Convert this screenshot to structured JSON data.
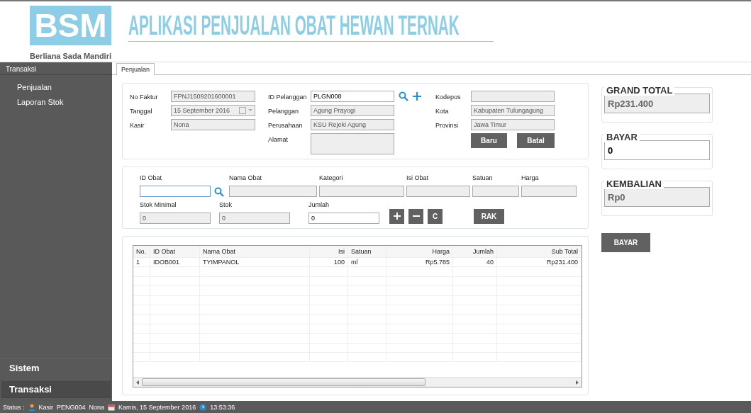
{
  "header": {
    "logo": "BSM",
    "company": "Berliana Sada Mandiri",
    "title": "APLIKASI PENJUALAN OBAT HEWAN TERNAK"
  },
  "sidebar": {
    "section": "Transaksi",
    "items": [
      {
        "label": "Penjualan"
      },
      {
        "label": "Laporan Stok"
      }
    ],
    "groups": [
      {
        "label": "Sistem",
        "selected": false
      },
      {
        "label": "Transaksi",
        "selected": true
      }
    ]
  },
  "tabs": [
    {
      "label": "Penjualan",
      "selected": true
    }
  ],
  "customer_panel": {
    "columns": [
      [
        {
          "label": "No Faktur",
          "value": "FPNJ1509201600001",
          "disabled": true
        },
        {
          "label": "Tanggal",
          "value": "15 September 2016",
          "disabled": true,
          "kind": "date"
        },
        {
          "label": "Kasir",
          "value": "Nona",
          "disabled": true
        }
      ],
      [
        {
          "label": "ID Pelanggan",
          "value": "PLGN008",
          "disabled": false,
          "kind": "lookup"
        },
        {
          "label": "Pelanggan",
          "value": "Agung Prayogi",
          "disabled": true
        },
        {
          "label": "Perusahaan",
          "value": "KSU Rejeki Agung",
          "disabled": true
        },
        {
          "label": "Alamat",
          "disabled": true,
          "kind": "multiline"
        }
      ],
      [
        {
          "label": "Kodepos",
          "disabled": true
        },
        {
          "label": "Kota",
          "value": "Kabupaten Tulungagung",
          "disabled": true
        },
        {
          "label": "Provinsi",
          "value": "Jawa Timur",
          "disabled": true
        }
      ]
    ],
    "buttons": [
      "Baru",
      "Batal"
    ]
  },
  "item_panel": {
    "top": [
      {
        "label": "ID Obat",
        "disabled": false,
        "focused": true,
        "kind": "lookup"
      },
      {
        "label": "Nama Obat",
        "disabled": true
      },
      {
        "label": "Kategori",
        "disabled": true
      },
      {
        "label": "Isi Obat",
        "disabled": true
      },
      {
        "label": "Satuan",
        "disabled": true
      },
      {
        "label": "Harga",
        "disabled": true
      }
    ],
    "bottom": [
      {
        "label": "Stok Minimal",
        "value": "0",
        "disabled": true
      },
      {
        "label": "Stok",
        "value": "0",
        "disabled": true
      },
      {
        "label": "Jumlah",
        "value": "0",
        "disabled": false
      }
    ],
    "actions": [
      {
        "kind": "add"
      },
      {
        "kind": "remove"
      },
      {
        "kind": "text",
        "label": "C"
      }
    ],
    "rak_button": "RAK"
  },
  "table": {
    "columns": [
      {
        "label": "No.",
        "numeric": false
      },
      {
        "label": "ID Obat",
        "numeric": false
      },
      {
        "label": "Nama Obat",
        "numeric": false
      },
      {
        "label": "Isi",
        "numeric": true
      },
      {
        "label": "Satuan",
        "numeric": false
      },
      {
        "label": "Harga",
        "numeric": true
      },
      {
        "label": "Jumlah",
        "numeric": true
      },
      {
        "label": "Sub Total",
        "numeric": true
      }
    ],
    "rows": [
      [
        "1",
        "IDOB001",
        "TYIMPANOL",
        "100",
        "ml",
        "Rp5.785",
        "40",
        "Rp231.400"
      ]
    ]
  },
  "summary": [
    {
      "title": "GRAND TOTAL",
      "value": "Rp231.400",
      "disabled": true
    },
    {
      "title": "BAYAR",
      "value": "0",
      "disabled": false
    },
    {
      "title": "KEMBALIAN",
      "value": "Rp0",
      "disabled": true
    }
  ],
  "pay_button": "BAYAR",
  "status_bar": {
    "label": "Status :",
    "role": "Kasir",
    "user_id": "PENG004",
    "user_name": "Nona",
    "date": "Kamis, 15 September 2016",
    "time": "13:53:36"
  }
}
